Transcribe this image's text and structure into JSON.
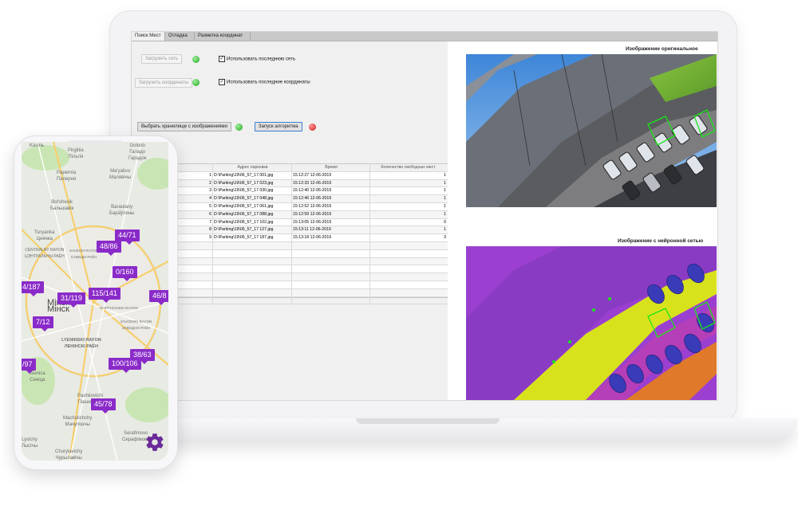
{
  "desktop_app": {
    "tabs": [
      "Поиск Мест",
      "Отладка",
      "Разметка координат"
    ],
    "load_net_button": "Загрузить сеть",
    "load_coords_button": "Загрузить координаты",
    "use_last_net_label": "Использовать последнюю сеть",
    "use_last_coords_label": "Использовать последние координаты",
    "select_storage_button": "Выбрать хранилище с изображениями",
    "run_algorithm_button": "Запуск алгоритма",
    "table": {
      "headers": [
        "",
        "Адрес парковки",
        "Время",
        "Количество свободных мест"
      ],
      "rows": [
        {
          "n": "1",
          "path": "D:\\Parking\\19\\06_57_17 001.jpg",
          "time": "15:12:27 12-06-2019",
          "free": "1"
        },
        {
          "n": "2",
          "path": "D:\\Parking\\19\\06_57_17 023.jpg",
          "time": "15:12:33 12-06-2019",
          "free": "1"
        },
        {
          "n": "3",
          "path": "D:\\Parking\\19\\06_57_17 030.jpg",
          "time": "15:12:40 12-06-2019",
          "free": "1"
        },
        {
          "n": "4",
          "path": "D:\\Parking\\19\\06_57_17 048.jpg",
          "time": "15:12:46 12-06-2019",
          "free": "1"
        },
        {
          "n": "5",
          "path": "D:\\Parking\\19\\06_57_17 061.jpg",
          "time": "15:12:52 12-06-2019",
          "free": "1"
        },
        {
          "n": "6",
          "path": "D:\\Parking\\19\\06_57_17 088.jpg",
          "time": "15:12:59 12-06-2019",
          "free": "1"
        },
        {
          "n": "7",
          "path": "D:\\Parking\\19\\06_57_17 102.jpg",
          "time": "15:13:05 12-06-2019",
          "free": "0"
        },
        {
          "n": "8",
          "path": "D:\\Parking\\19\\06_57_17 127.jpg",
          "time": "15:13:11 12-06-2019",
          "free": "1"
        },
        {
          "n": "9",
          "path": "D:\\Parking\\19\\06_57_17 187.jpg",
          "time": "15:13:18 12-06-2019",
          "free": "3"
        }
      ]
    },
    "original_image_title": "Изображение оригинальное",
    "nn_image_title": "Изображение с нейронной сетью"
  },
  "mobile_map": {
    "city": "Minsk",
    "city_local": "Мінск",
    "pins": [
      "44/71",
      "48/86",
      "0/160",
      "115/141",
      "31/119",
      "4/187",
      "46/8",
      "7/12",
      "38/63",
      "100/106",
      "/97",
      "45/78"
    ],
    "places": [
      {
        "lat": "Kasinь"
      },
      {
        "lat": "Pirgitiia",
        "local": "Пільгія"
      },
      {
        "lat": "Golodo",
        "local": "Галадо",
        "extra": "Гарадок"
      },
      {
        "lat": "Papernia",
        "local": "Паперня"
      },
      {
        "lat": "Ma'yalivo",
        "local": "Малявічы"
      },
      {
        "lat": "Bol'shevik",
        "local": "Бальшавік"
      },
      {
        "lat": "Baraulany",
        "local": "Барáўляны"
      },
      {
        "lat": "Tsnyanka",
        "local": "Цнянка"
      },
      {
        "lat": "CENTRALNY RAYON",
        "local": "ЦЭНТРАЛЬНЫ РАЁН"
      },
      {
        "lat": "SAVECKI RAYON",
        "local": "САВЕЦКІ РАЁН"
      },
      {
        "lat": "PARTYZANSKI RAYON"
      },
      {
        "lat": "ZAVODSKI RAYON",
        "local": "ЗАВОДСКІ РАЁН"
      },
      {
        "lat": "LYENINSKI RAYON",
        "local": "ЛЕНІНСКІ РАЁН"
      },
      {
        "lat": "Sienica",
        "local": "Сеніца"
      },
      {
        "lat": "Pashkovichi",
        "local": "Пашковічы"
      },
      {
        "lat": "Machulishchy",
        "local": "Мачулішчы"
      },
      {
        "lat": "Serafimovo",
        "local": "Серафімова"
      },
      {
        "lat": "Churylavichy",
        "local": "Чурылавічы"
      },
      {
        "lat": "Lysichy",
        "local": "Лысічы"
      }
    ],
    "settings_icon": "gear-icon",
    "accent_color": "#8a2bc9"
  }
}
